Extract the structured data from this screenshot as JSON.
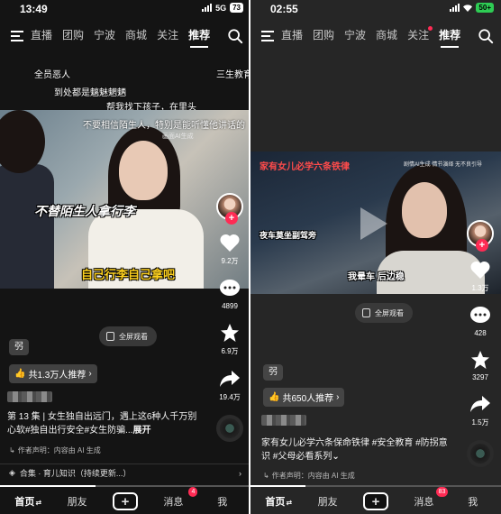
{
  "left": {
    "status": {
      "time": "13:49",
      "network": "5G",
      "battery": "73"
    },
    "nav": {
      "tabs": [
        "直播",
        "团购",
        "宁波",
        "商城",
        "关注",
        "推荐"
      ],
      "active": "推荐"
    },
    "danmu": [
      "全员恶人",
      "到处都是魑魅魍魉",
      "帮我找下孩子，在里头",
      "三生教育",
      "不要相信陌生人，特别是能听懂他讲话的"
    ],
    "video": {
      "caption_main": "不替陌生人拿行李",
      "caption_sub": "自己行李自己拿吧",
      "watermark": "画面AI生成"
    },
    "fullscreen_label": "全屏观看",
    "actions": {
      "likes": "9.2万",
      "comments": "4899",
      "favorites": "6.9万",
      "shares": "19.4万"
    },
    "author_tag": "弜",
    "recommend": "共1.3万人推荐",
    "description": "第 13 集 | 女生独自出远门，遇上这6种人千万别心软#独自出行安全#女生防骗...",
    "more": "展开",
    "author_note": "作者声明：内容由 AI 生成",
    "collection": "合集 · 育儿知识（持续更新...）",
    "bottom_nav": {
      "home": "首页",
      "friends": "朋友",
      "messages": "消息",
      "me": "我",
      "badge": "4"
    }
  },
  "right": {
    "status": {
      "time": "02:55",
      "battery": "50+"
    },
    "nav": {
      "tabs": [
        "直播",
        "团购",
        "宁波",
        "商城",
        "关注",
        "推荐"
      ],
      "active": "推荐"
    },
    "video": {
      "title_overlay": "家有女儿必学六条铁律",
      "watermark": "剧情AI生成  情节演绎  无不良引导",
      "caption_1": "夜车莫坐副驾旁",
      "caption_2": "我晕车 后边稳"
    },
    "fullscreen_label": "全屏观看",
    "actions": {
      "likes": "1.3万",
      "comments": "428",
      "favorites": "3297",
      "shares": "1.5万"
    },
    "author_tag": "弜",
    "recommend": "共650人推荐",
    "description": "家有女儿必学六条保命铁律 #安全教育 #防拐意识 #父母必看系列",
    "author_note": "作者声明：内容由 AI 生成",
    "bottom_nav": {
      "home": "首页",
      "friends": "朋友",
      "messages": "消息",
      "me": "我",
      "badge": "83"
    }
  },
  "colors": {
    "accent": "#ff2b54",
    "battery_green": "#2ecc54"
  }
}
